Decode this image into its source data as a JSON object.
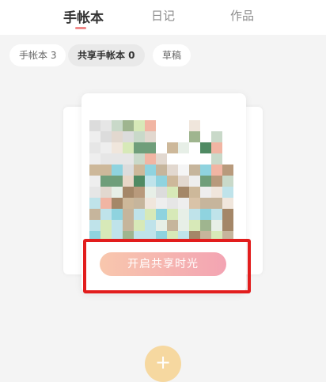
{
  "header": {
    "tabs": [
      {
        "label": "手帐本",
        "active": true
      },
      {
        "label": "日记",
        "active": false
      },
      {
        "label": "作品",
        "active": false
      }
    ]
  },
  "filters": {
    "chips": [
      {
        "label": "手帐本 3",
        "active": false
      },
      {
        "label": "共享手帐本 0",
        "active": true
      },
      {
        "label": "草稿",
        "active": false
      }
    ]
  },
  "card": {
    "cover_image": "mosaic-thumbnail",
    "action_label": "开启共享时光"
  },
  "fab": {
    "icon": "plus-icon",
    "label": "+"
  },
  "colors": {
    "accent": "#f08a8a",
    "button_gradient_start": "#f8c7ad",
    "button_gradient_end": "#f3a4b3",
    "highlight_box": "#e21d1d"
  }
}
